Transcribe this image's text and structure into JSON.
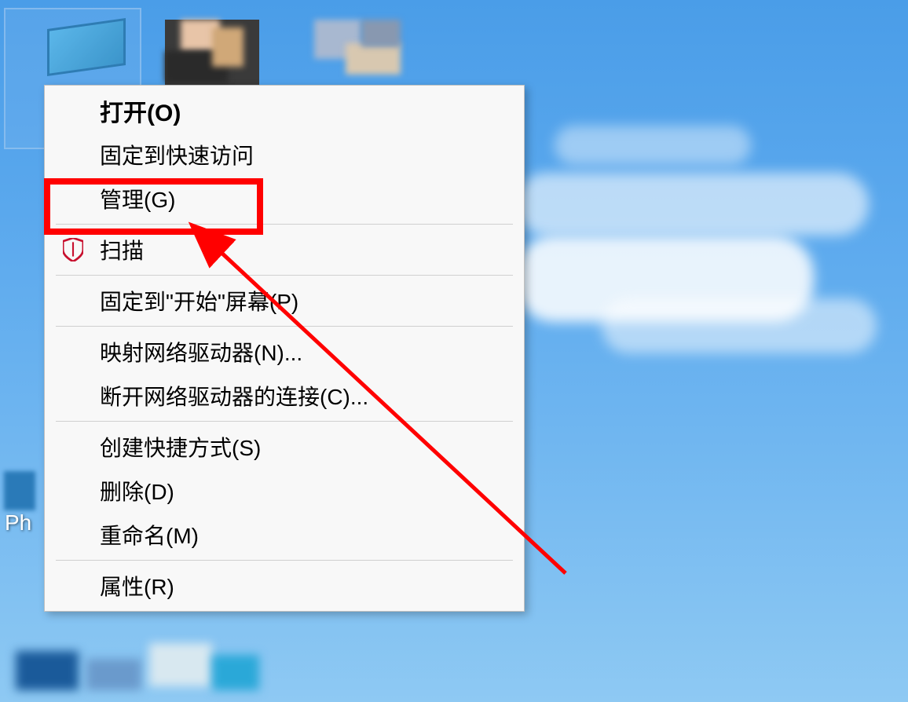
{
  "menu": {
    "items": [
      {
        "label": "打开(O)",
        "bold": true,
        "icon": null
      },
      {
        "label": "固定到快速访问",
        "bold": false,
        "icon": null
      },
      {
        "label": "管理(G)",
        "bold": false,
        "icon": null,
        "highlighted": true
      }
    ],
    "scan": {
      "label": "扫描",
      "icon": "shield-icon"
    },
    "pin_start": {
      "label": "固定到\"开始\"屏幕(P)"
    },
    "map_drive": {
      "label": "映射网络驱动器(N)..."
    },
    "disconnect_drive": {
      "label": "断开网络驱动器的连接(C)..."
    },
    "create_shortcut": {
      "label": "创建快捷方式(S)"
    },
    "delete": {
      "label": "删除(D)"
    },
    "rename": {
      "label": "重命名(M)"
    },
    "properties": {
      "label": "属性(R)"
    }
  },
  "desktop": {
    "partial_label": "Ph"
  },
  "annotations": {
    "highlight_color": "#ff0000",
    "arrow_color": "#ff0000"
  }
}
